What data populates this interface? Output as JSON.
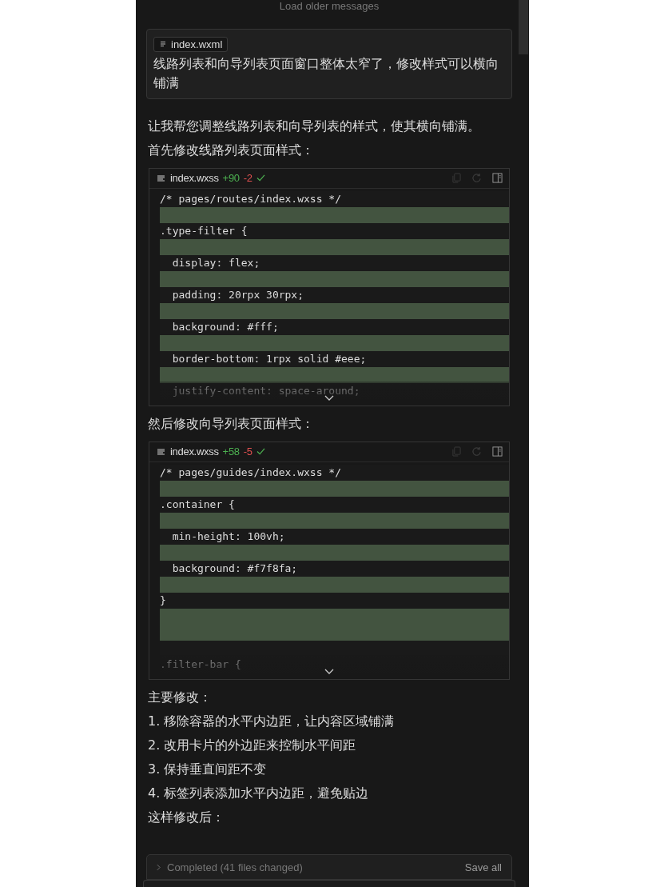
{
  "load_older": "Load older messages",
  "user_message": {
    "attachment": "index.wxml",
    "text": "线路列表和向导列表页面窗口整体太窄了，修改样式可以横向铺满"
  },
  "assistant": [
    {
      "kind": "text",
      "text": "让我帮您调整线路列表和向导列表的样式，使其横向铺满。"
    },
    {
      "kind": "text",
      "text": "首先修改线路列表页面样式："
    },
    {
      "kind": "code",
      "file": "index.wxss",
      "added": "+90",
      "removed": "-2",
      "applied": true,
      "collapsed": true,
      "lines": [
        {
          "text": "/* pages/routes/index.wxss */",
          "highlighted": false
        },
        {
          "highlighted": true
        },
        {
          "text": ".type-filter {",
          "highlighted": false
        },
        {
          "highlighted": true
        },
        {
          "text": "  display: flex;",
          "highlighted": false
        },
        {
          "highlighted": true
        },
        {
          "text": "  padding: 20rpx 30rpx;",
          "highlighted": false
        },
        {
          "highlighted": true
        },
        {
          "text": "  background: #fff;",
          "highlighted": false
        },
        {
          "highlighted": true
        },
        {
          "text": "  border-bottom: 1rpx solid #eee;",
          "highlighted": false
        },
        {
          "highlighted": true
        },
        {
          "text": "  justify-content: space-around;",
          "highlighted": false
        }
      ]
    },
    {
      "kind": "text",
      "text": "然后修改向导列表页面样式："
    },
    {
      "kind": "code",
      "file": "index.wxss",
      "added": "+58",
      "removed": "-5",
      "applied": true,
      "collapsed": true,
      "lines": [
        {
          "text": "/* pages/guides/index.wxss */",
          "highlighted": false
        },
        {
          "highlighted": true
        },
        {
          "text": ".container {",
          "highlighted": false
        },
        {
          "highlighted": true
        },
        {
          "text": "  min-height: 100vh;",
          "highlighted": false
        },
        {
          "highlighted": true
        },
        {
          "text": "  background: #f7f8fa;",
          "highlighted": false
        },
        {
          "highlighted": true
        },
        {
          "text": "}",
          "highlighted": false
        },
        {
          "highlighted": true
        },
        {
          "highlighted": true
        },
        {
          "highlighted": false
        },
        {
          "text": ".filter-bar {",
          "highlighted": false
        }
      ]
    },
    {
      "kind": "text",
      "text": "主要修改："
    },
    {
      "kind": "text",
      "text": "1. 移除容器的水平内边距，让内容区域铺满"
    },
    {
      "kind": "text",
      "text": "2. 改用卡片的外边距来控制水平间距"
    },
    {
      "kind": "text",
      "text": "3. 保持垂直间距不变"
    },
    {
      "kind": "text",
      "text": "4. 标签列表添加水平内边距，避免贴边"
    },
    {
      "kind": "text",
      "text": "这样修改后："
    }
  ],
  "status": {
    "expanded": false,
    "label": "Completed (41 files changed)",
    "action": "Save all"
  }
}
